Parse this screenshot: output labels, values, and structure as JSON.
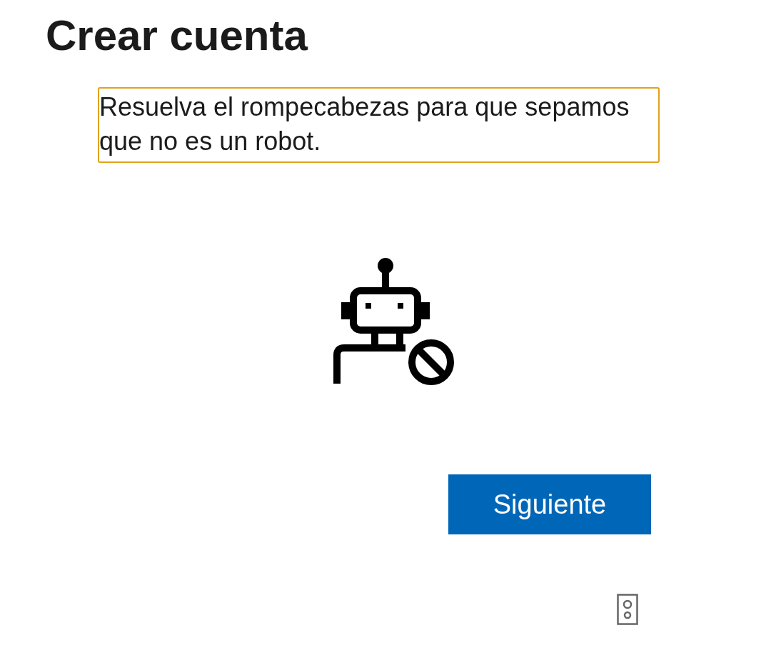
{
  "title": "Crear cuenta",
  "prompt": {
    "text": "Resuelva el rompecabezas para que sepamos que no es un robot.",
    "focused": true
  },
  "buttons": [
    {
      "label": "Siguiente",
      "kind": "primary"
    }
  ]
}
